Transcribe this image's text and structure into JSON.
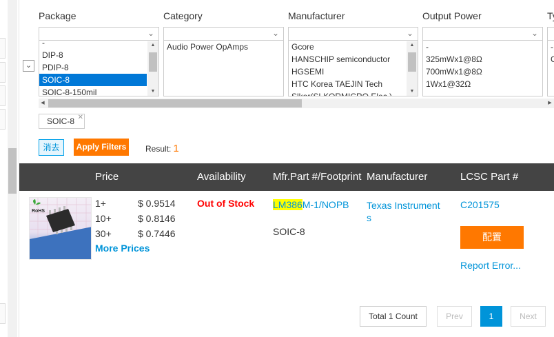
{
  "filters": {
    "package": {
      "label": "Package",
      "items": [
        "-",
        "DIP-8",
        "PDIP-8",
        "SOIC-8",
        "SOIC-8-150mil"
      ],
      "selected": "SOIC-8"
    },
    "category": {
      "label": "Category",
      "items": [
        "Audio Power OpAmps"
      ]
    },
    "manufacturer": {
      "label": "Manufacturer",
      "items": [
        "Gcore",
        "HANSCHIP semiconductor",
        "HGSEMI",
        "HTC Korea TAEJIN Tech",
        "Slkor(SLKORMICRO Elec.)"
      ]
    },
    "output_power": {
      "label": "Output Power",
      "items": [
        "-",
        "325mWx1@8Ω",
        "700mWx1@8Ω",
        "1Wx1@32Ω"
      ]
    },
    "type": {
      "label": "Ty",
      "items": [
        "-",
        "C"
      ]
    }
  },
  "active_chip": "SOIC-8",
  "actions": {
    "clear_label": "消去",
    "apply_label": "Apply Filters",
    "result_label": "Result:",
    "result_count": "1"
  },
  "table": {
    "headers": {
      "price": "Price",
      "availability": "Availability",
      "mfr_part": "Mfr.Part #/Footprint",
      "manufacturer": "Manufacturer",
      "lcsc": "LCSC Part #"
    },
    "row": {
      "rohs": "RoHS",
      "prices": [
        {
          "qty": "1+",
          "price": "$ 0.9514"
        },
        {
          "qty": "10+",
          "price": "$ 0.8146"
        },
        {
          "qty": "30+",
          "price": "$ 0.7446"
        }
      ],
      "more_prices": "More Prices",
      "availability": "Out of Stock",
      "mfr_part_highlight": "LM386",
      "mfr_part_rest": "M-1/NOPB",
      "footprint": "SOIC-8",
      "manufacturer": "Texas Instruments",
      "lcsc_part": "C201575",
      "config_label": "配置",
      "report_label": "Report Error..."
    }
  },
  "pagination": {
    "total": "Total 1 Count",
    "prev": "Prev",
    "current": "1",
    "next": "Next"
  },
  "colors": {
    "accent_orange": "#ff7800",
    "link_blue": "#0094d9",
    "header_dark": "#444444",
    "out_of_stock": "#ff0000",
    "highlight": "#ffff00"
  }
}
